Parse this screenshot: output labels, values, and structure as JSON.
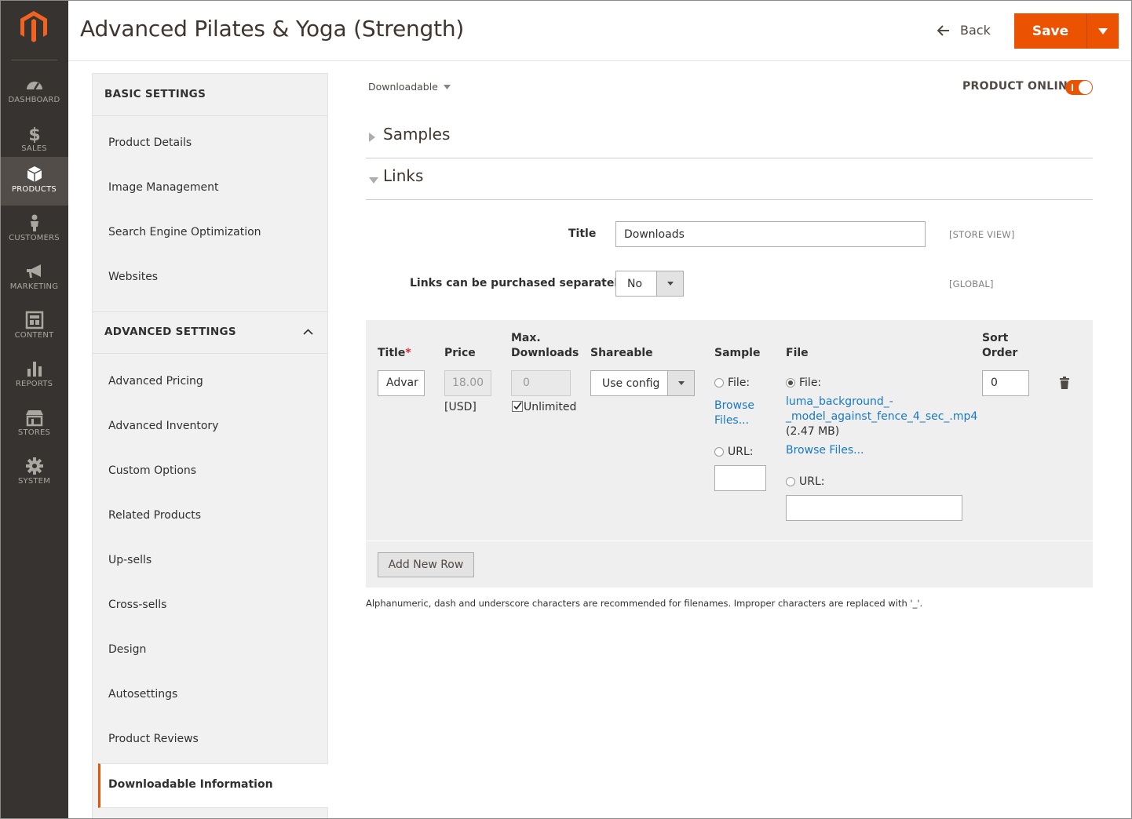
{
  "nav": {
    "items": [
      {
        "label": "DASHBOARD",
        "icon": "dashboard-icon"
      },
      {
        "label": "SALES",
        "icon": "dollar-icon"
      },
      {
        "label": "PRODUCTS",
        "icon": "box-icon"
      },
      {
        "label": "CUSTOMERS",
        "icon": "person-icon"
      },
      {
        "label": "MARKETING",
        "icon": "megaphone-icon"
      },
      {
        "label": "CONTENT",
        "icon": "layout-icon"
      },
      {
        "label": "REPORTS",
        "icon": "bar-chart-icon"
      },
      {
        "label": "STORES",
        "icon": "storefront-icon"
      },
      {
        "label": "SYSTEM",
        "icon": "gear-icon"
      }
    ],
    "active": "PRODUCTS"
  },
  "header": {
    "title": "Advanced Pilates & Yoga (Strength)",
    "back_label": "Back",
    "save_label": "Save"
  },
  "settings": {
    "basic_title": "BASIC SETTINGS",
    "basic_items": [
      "Product Details",
      "Image Management",
      "Search Engine Optimization",
      "Websites"
    ],
    "advanced_title": "ADVANCED SETTINGS",
    "advanced_items": [
      "Advanced Pricing",
      "Advanced Inventory",
      "Custom Options",
      "Related Products",
      "Up-sells",
      "Cross-sells",
      "Design",
      "Autosettings",
      "Product Reviews"
    ],
    "active_item": "Downloadable Information"
  },
  "main": {
    "product_type": "Downloadable",
    "product_online_label": "PRODUCT ONLINE",
    "product_online": true,
    "samples_title": "Samples",
    "links_title": "Links",
    "title_label": "Title",
    "title_value": "Downloads",
    "title_scope": "[STORE VIEW]",
    "separately_label": "Links can be purchased separately",
    "separately_value": "No",
    "separately_scope": "[GLOBAL]"
  },
  "grid": {
    "headers": {
      "title": "Title",
      "required_mark": "*",
      "price": "Price",
      "max_downloads_1": "Max.",
      "max_downloads_2": "Downloads",
      "shareable": "Shareable",
      "sample": "Sample",
      "file": "File",
      "sort_order_1": "Sort",
      "sort_order_2": "Order"
    },
    "row": {
      "title": "Advar",
      "price": "18.00",
      "currency": "[USD]",
      "max_downloads": "0",
      "unlimited_label": "Unlimited",
      "unlimited_checked": true,
      "shareable": "Use config",
      "sample_file_label": "File:",
      "sample_browse_1": "Browse",
      "sample_browse_2": "Files...",
      "sample_url_label": "URL:",
      "file_label": "File:",
      "file_name_1": "luma_background_-",
      "file_name_2": "_model_against_fence_4_sec_.mp4",
      "file_size": "(2.47 MB)",
      "file_browse": "Browse Files...",
      "file_url_label": "URL:",
      "sort_order": "0"
    },
    "add_row_label": "Add New Row"
  },
  "note": "Alphanumeric, dash and underscore characters are recommended for filenames. Improper characters are replaced with '_'.",
  "colors": {
    "accent": "#eb5202",
    "nav_bg": "#373330",
    "link": "#1979c3"
  }
}
